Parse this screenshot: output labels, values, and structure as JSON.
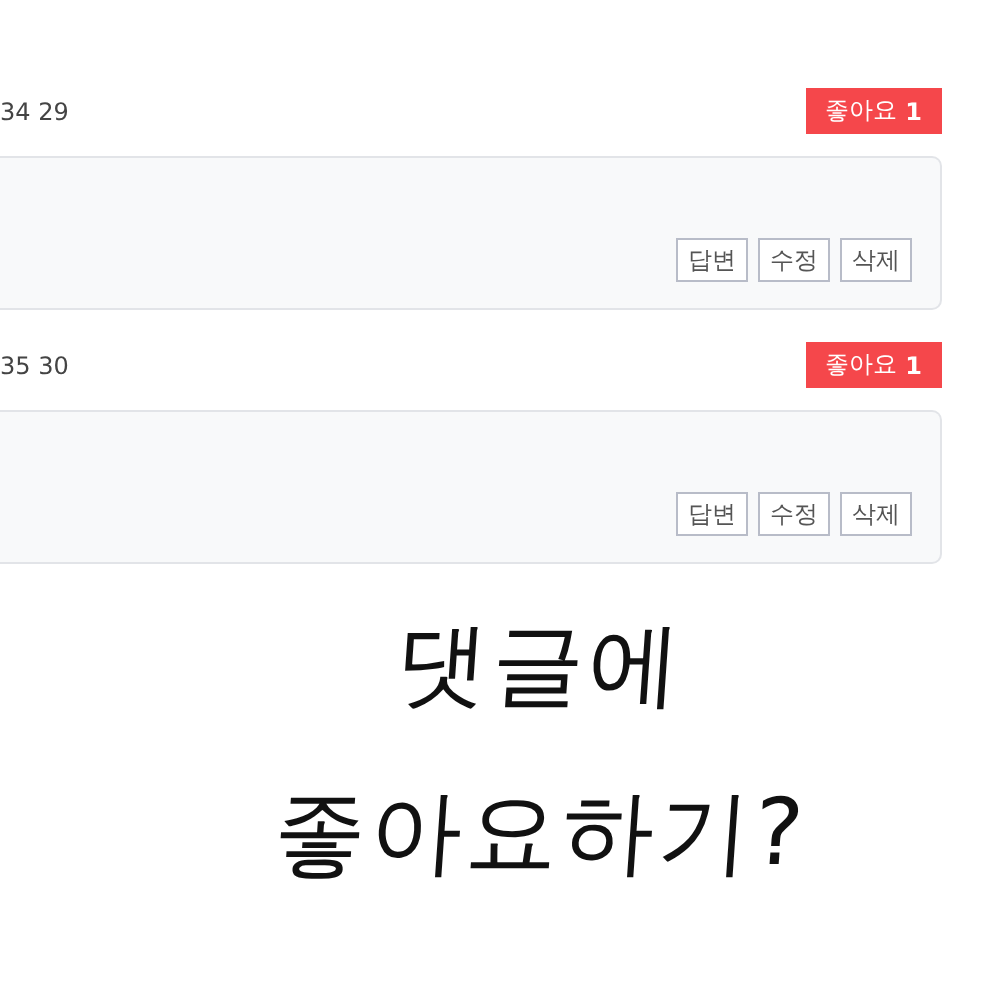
{
  "comments": [
    {
      "time": "34 29",
      "like": {
        "label": "좋아요",
        "count": "1"
      },
      "actions": [
        "답변",
        "수정",
        "삭제"
      ]
    },
    {
      "time": "35 30",
      "like": {
        "label": "좋아요",
        "count": "1"
      },
      "actions": [
        "답변",
        "수정",
        "삭제"
      ]
    }
  ],
  "caption": [
    "댓글에",
    "좋아요하기?"
  ]
}
